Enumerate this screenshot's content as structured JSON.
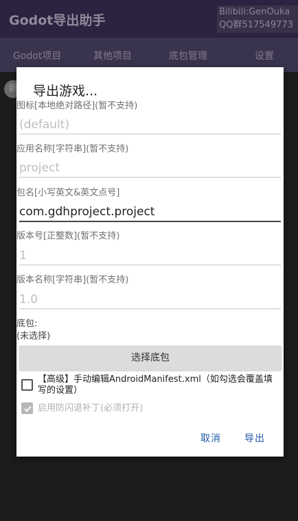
{
  "app": {
    "title": "Godot导出助手",
    "contact_line1": "Bilibili:GenOuka",
    "contact_line2": "QQ群517549773",
    "fab_peek": "新"
  },
  "tabs": [
    {
      "label": "Godot项目"
    },
    {
      "label": "其他项目"
    },
    {
      "label": "底包管理"
    },
    {
      "label": "设置"
    }
  ],
  "dialog": {
    "title": "导出游戏...",
    "fields": [
      {
        "label": "图标[本地绝对路径](暂不支持)",
        "value": "",
        "placeholder": "(default)"
      },
      {
        "label": "应用名称[字符串](暂不支持)",
        "value": "",
        "placeholder": "project"
      },
      {
        "label": "包名[小写英文&英文点号]",
        "value": "com.gdhproject.project",
        "placeholder": ""
      },
      {
        "label": "版本号[正整数](暂不支持)",
        "value": "",
        "placeholder": "1"
      },
      {
        "label": "版本名称[字符串](暂不支持)",
        "value": "",
        "placeholder": "1.0"
      }
    ],
    "base_package_label": "底包:",
    "base_package_value": "(未选择)",
    "select_button": "选择底包",
    "advanced_checkbox": "【高级】手动编辑AndroidManifest.xml（如勾选会覆盖填写的设置）",
    "advanced_checked": false,
    "antiflash_checkbox": "启用防闪退补丁(必须打开)",
    "antiflash_checked": true,
    "cancel_button": "取消",
    "export_button": "导出"
  }
}
